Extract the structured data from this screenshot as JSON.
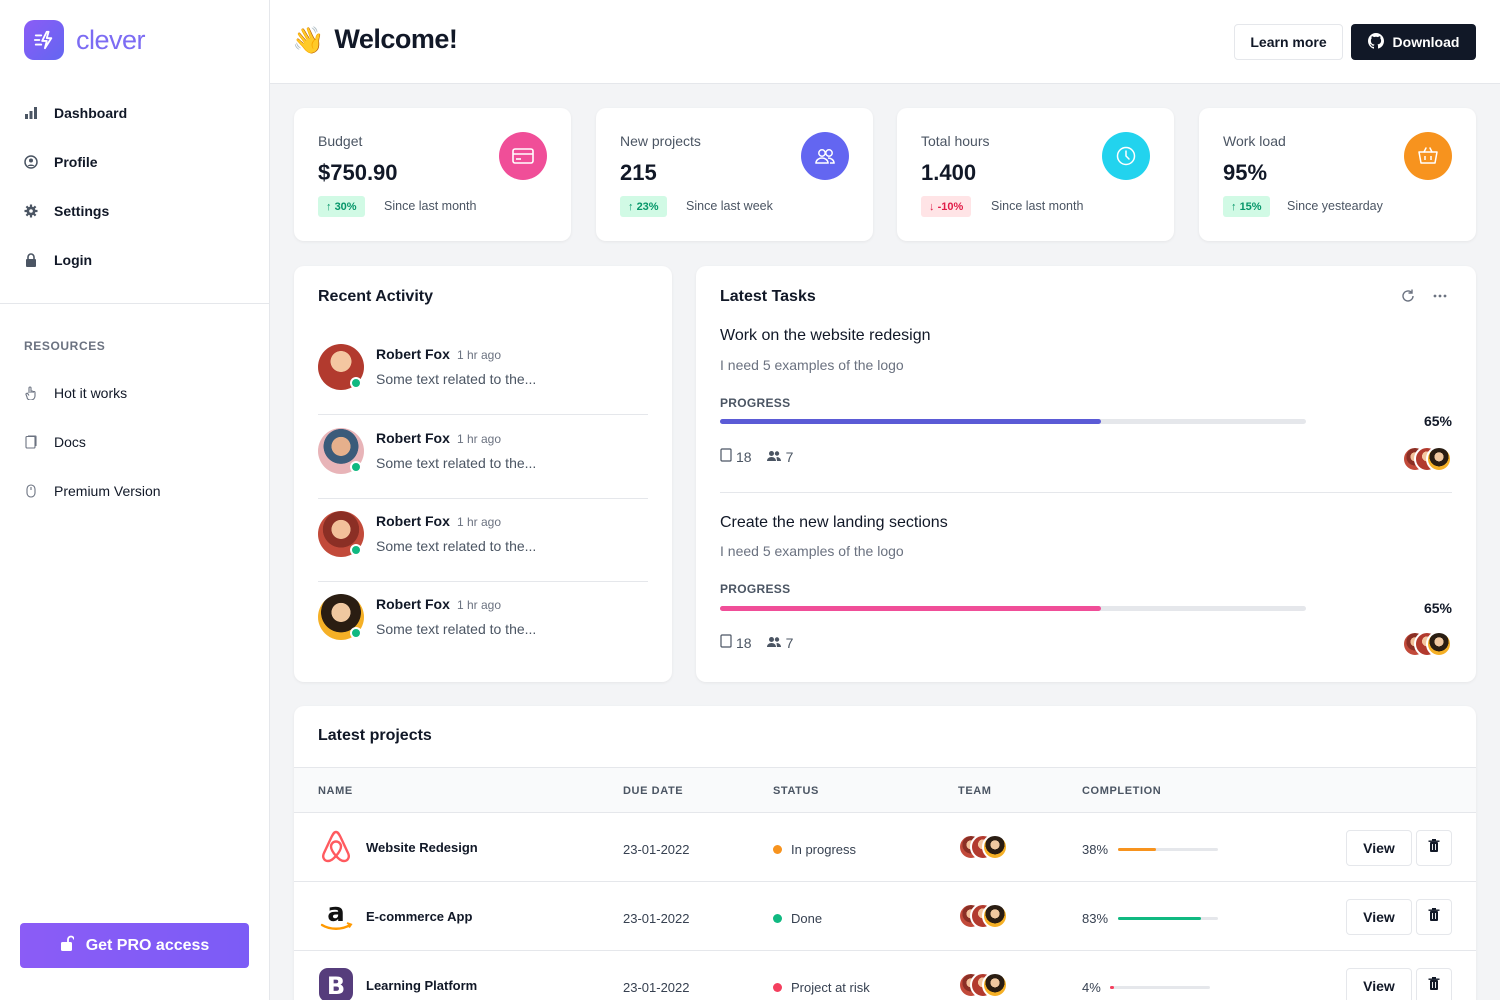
{
  "brand": {
    "name": "clever"
  },
  "header": {
    "emoji": "👋",
    "title": "Welcome!",
    "learn_more": "Learn more",
    "download": "Download"
  },
  "sidebar": {
    "nav": [
      {
        "label": "Dashboard",
        "icon": "bar-chart-icon"
      },
      {
        "label": "Profile",
        "icon": "user-circle-icon"
      },
      {
        "label": "Settings",
        "icon": "gear-icon"
      },
      {
        "label": "Login",
        "icon": "lock-icon"
      }
    ],
    "resources_title": "RESOURCES",
    "resources": [
      {
        "label": "Hot it works",
        "icon": "pointer-hand-icon"
      },
      {
        "label": "Docs",
        "icon": "document-icon"
      },
      {
        "label": "Premium Version",
        "icon": "mouse-icon"
      }
    ],
    "pro_button": "Get PRO access"
  },
  "stats": [
    {
      "label": "Budget",
      "value": "$750.90",
      "change": "30%",
      "trend": "up",
      "since": "Since last month",
      "icon": "credit-card-icon",
      "color": "#f04e98"
    },
    {
      "label": "New projects",
      "value": "215",
      "change": "23%",
      "trend": "up",
      "since": "Since last week",
      "icon": "users-icon",
      "color": "#6366f1"
    },
    {
      "label": "Total hours",
      "value": "1.400",
      "change": "-10%",
      "trend": "down",
      "since": "Since last month",
      "icon": "clock-icon",
      "color": "#22d3ee"
    },
    {
      "label": "Work load",
      "value": "95%",
      "change": "15%",
      "trend": "up",
      "since": "Since yestearday",
      "icon": "basket-icon",
      "color": "#f7931e"
    }
  ],
  "activity": {
    "title": "Recent Activity",
    "items": [
      {
        "name": "Robert Fox",
        "time": "1 hr ago",
        "text": "Some text related to the..."
      },
      {
        "name": "Robert Fox",
        "time": "1 hr ago",
        "text": "Some text related to the..."
      },
      {
        "name": "Robert Fox",
        "time": "1 hr ago",
        "text": "Some text related to the..."
      },
      {
        "name": "Robert Fox",
        "time": "1 hr ago",
        "text": "Some text related to the..."
      }
    ]
  },
  "tasks": {
    "title": "Latest Tasks",
    "items": [
      {
        "title": "Work on the website redesign",
        "desc": "I need 5 examples of the logo",
        "progress_label": "PROGRESS",
        "progress": 0.65,
        "progress_text": "65%",
        "files": "18",
        "members": "7",
        "color": "#5b5bd6"
      },
      {
        "title": "Create the new landing sections",
        "desc": "I need 5 examples of the logo",
        "progress_label": "PROGRESS",
        "progress": 0.65,
        "progress_text": "65%",
        "files": "18",
        "members": "7",
        "color": "#f04e98"
      }
    ]
  },
  "projects": {
    "title": "Latest projects",
    "columns": [
      "NAME",
      "DUE DATE",
      "STATUS",
      "TEAM",
      "COMPLETION"
    ],
    "rows": [
      {
        "name": "Website Redesign",
        "logo": "airbnb-logo",
        "due": "23-01-2022",
        "status": "In progress",
        "status_color": "#f7931e",
        "completion": 0.38,
        "completion_text": "38%",
        "bar_color": "#f7931e",
        "view": "View"
      },
      {
        "name": "E-commerce App",
        "logo": "amazon-logo",
        "due": "23-01-2022",
        "status": "Done",
        "status_color": "#10b981",
        "completion": 0.83,
        "completion_text": "83%",
        "bar_color": "#10b981",
        "view": "View"
      },
      {
        "name": "Learning Platform",
        "logo": "bootstrap-logo",
        "due": "23-01-2022",
        "status": "Project at risk",
        "status_color": "#f43f5e",
        "completion": 0.04,
        "completion_text": "4%",
        "bar_color": "#f43f5e",
        "view": "View"
      }
    ]
  }
}
